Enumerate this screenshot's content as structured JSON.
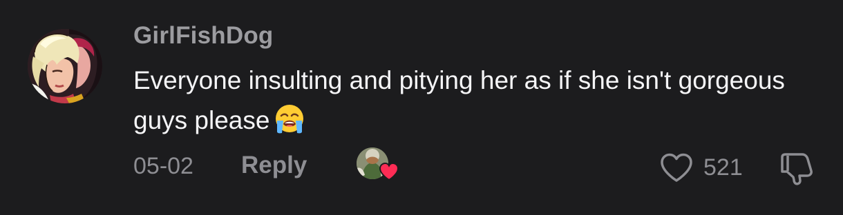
{
  "comment": {
    "username": "GirlFishDog",
    "text": "Everyone insulting and pitying her as if she isn't gorgeous guys please",
    "emoji": "loudly-crying-face",
    "date": "05-02",
    "reply_label": "Reply",
    "like_count": "521",
    "liked_by_creator": true
  },
  "colors": {
    "background": "#1c1c1e",
    "username": "#9c9ca0",
    "text": "#f5f5f7",
    "meta": "#8e8e93",
    "creator_heart": "#fe2c55"
  }
}
